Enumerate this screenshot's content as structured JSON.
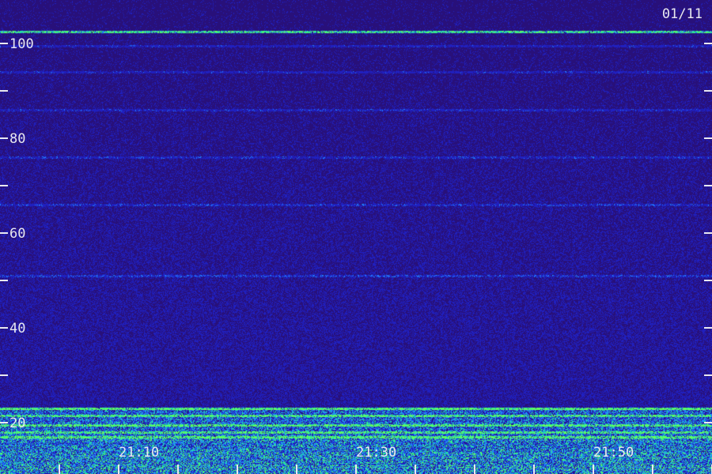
{
  "chart_data": {
    "type": "heatmap",
    "title": "",
    "date_label": "01/11",
    "xlabel": "",
    "ylabel": "",
    "y_ticks": [
      100,
      80,
      60,
      40,
      20
    ],
    "y_tick_labels": [
      "100",
      "80",
      "60",
      "40",
      "20"
    ],
    "y_minor_ticks": [
      90,
      70,
      50,
      30
    ],
    "ylim": [
      16,
      104
    ],
    "x_ticks": [
      "21:10",
      "21:30",
      "21:50"
    ],
    "x_tick_minutes": [
      1270,
      1290,
      1310
    ],
    "x_minor_tick_minutes": [
      1263,
      1268,
      1273,
      1278,
      1283,
      1288,
      1293,
      1298,
      1303,
      1308,
      1313,
      1318
    ],
    "xlim_minutes": [
      1258,
      1318
    ],
    "noise_floor_top": 23,
    "bands": [
      {
        "value": 102.5,
        "intensity": "strong"
      },
      {
        "value": 99.5,
        "intensity": "weak"
      },
      {
        "value": 94,
        "intensity": "weak"
      },
      {
        "value": 86,
        "intensity": "weak"
      },
      {
        "value": 76,
        "intensity": "weak"
      },
      {
        "value": 66,
        "intensity": "weak"
      },
      {
        "value": 51,
        "intensity": "weak"
      },
      {
        "value": 23,
        "intensity": "strong"
      },
      {
        "value": 21.5,
        "intensity": "medium"
      },
      {
        "value": 19.5,
        "intensity": "medium"
      },
      {
        "value": 18,
        "intensity": "medium"
      },
      {
        "value": 17,
        "intensity": "medium"
      }
    ],
    "colors": {
      "background": "#28107a",
      "low": "#2020c0",
      "mid": "#2080ff",
      "high": "#20e8a0",
      "peak": "#60ff60",
      "labels": "#e8e8f0"
    },
    "grid": false
  }
}
